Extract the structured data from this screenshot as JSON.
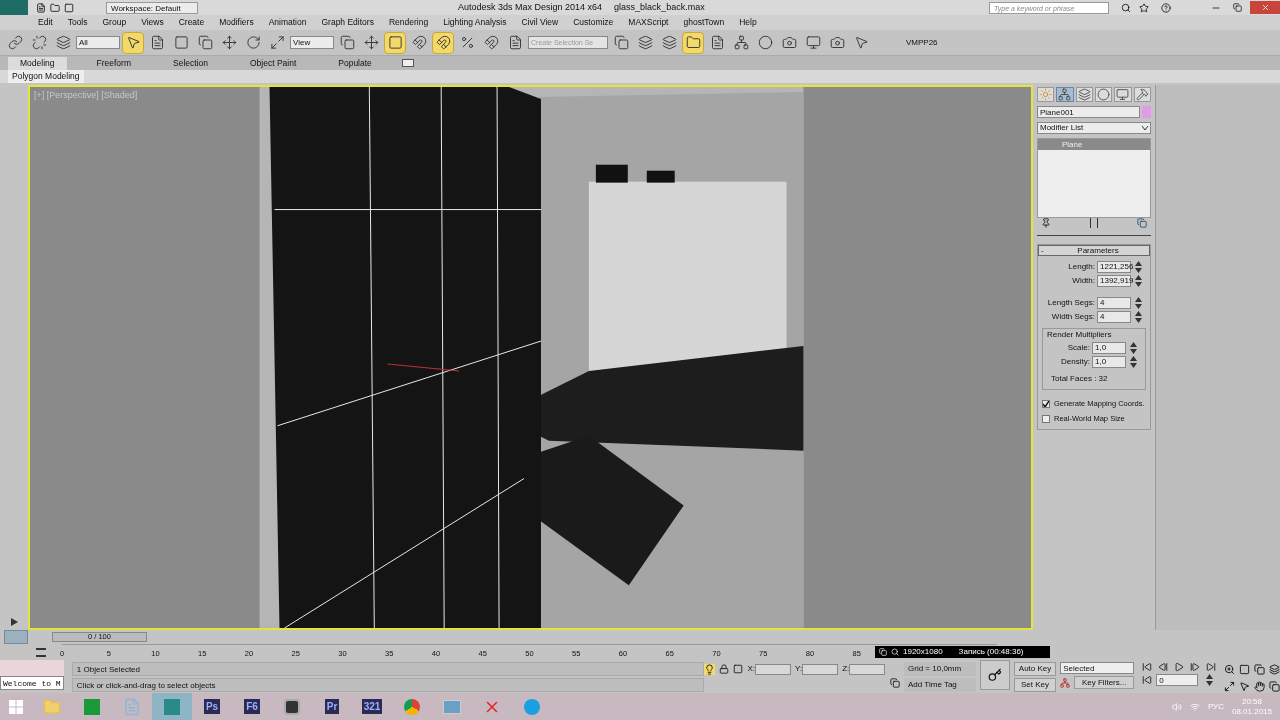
{
  "title_bar": {
    "workspace": "Workspace: Default",
    "app_title": "Autodesk 3ds Max Design 2014 x64",
    "file_name": "glass_black_back.max",
    "search_placeholder": "Type a keyword or phrase"
  },
  "menu": [
    "Edit",
    "Tools",
    "Group",
    "Views",
    "Create",
    "Modifiers",
    "Animation",
    "Graph Editors",
    "Rendering",
    "Lighting Analysis",
    "Civil View",
    "Customize",
    "MAXScript",
    "ghostTown",
    "Help"
  ],
  "toolbar": {
    "selection_filter": "All",
    "reference_coord": "View",
    "named_selection": "Create Selection Se",
    "custom_label": "VMPP26"
  },
  "ribbon_tabs": [
    {
      "label": "Modeling",
      "selected": true
    },
    {
      "label": "Freeform",
      "selected": false
    },
    {
      "label": "Selection",
      "selected": false
    },
    {
      "label": "Object Paint",
      "selected": false
    },
    {
      "label": "Populate",
      "selected": false
    }
  ],
  "ribbon_panel": "Polygon Modeling",
  "viewport": {
    "label": "[+] [Perspective] [Shaded]",
    "active": true
  },
  "command_panel": {
    "tabs": [
      {
        "kind": "create",
        "selected": false
      },
      {
        "kind": "modify",
        "selected": true
      },
      {
        "kind": "hierarchy",
        "selected": false
      },
      {
        "kind": "motion",
        "selected": false
      },
      {
        "kind": "display",
        "selected": false
      },
      {
        "kind": "utilities",
        "selected": false
      }
    ],
    "object_name": "Plane001",
    "modifier_list": "Modifier List",
    "stack": [
      {
        "label": "Plane",
        "selected": true
      }
    ],
    "rollout": "Parameters",
    "rollout_sign": "-",
    "fields": [
      {
        "label": "Length:",
        "value": "1221,256"
      },
      {
        "label": "Width:",
        "value": "1392,919"
      },
      {
        "label": "Length Segs:",
        "value": "4"
      },
      {
        "label": "Width Segs:",
        "value": "4"
      }
    ],
    "group": "Render Multipliers",
    "group_fields": [
      {
        "label": "Scale:",
        "value": "1,0"
      },
      {
        "label": "Density:",
        "value": "1,0"
      }
    ],
    "total_faces": "Total Faces : 32",
    "checkboxes": [
      {
        "label": "Generate Mapping Coords.",
        "checked": true
      },
      {
        "label": "Real-World Map Size",
        "checked": false
      }
    ]
  },
  "timeline": {
    "frame": "0 / 100",
    "ticks": [
      "0",
      "5",
      "10",
      "15",
      "20",
      "25",
      "30",
      "35",
      "40",
      "45",
      "50",
      "55",
      "60",
      "65",
      "70",
      "75",
      "80",
      "85"
    ]
  },
  "recorder": {
    "resolution": "1920x1080",
    "status": "Запись (00:48:36)"
  },
  "status": {
    "listener": "Welcome to M",
    "selected": "1 Object Selected",
    "prompt": "Click or click-and-drag to select objects",
    "coords": [
      "X:",
      "Y:",
      "Z:"
    ],
    "grid": "Grid = 10,0mm",
    "time_tag": "Add Time Tag",
    "auto_key": "Auto Key",
    "set_key": "Set Key",
    "key_mode": "Selected",
    "key_filters": "Key Filters...",
    "frame": "0"
  },
  "taskbar": {
    "apps": [
      {
        "kind": "folder"
      },
      {
        "kind": "store"
      },
      {
        "kind": "notepad"
      },
      {
        "kind": "max"
      },
      {
        "kind": "text",
        "label": "Ps"
      },
      {
        "kind": "text",
        "label": "F6"
      },
      {
        "kind": "max2"
      },
      {
        "kind": "text",
        "label": "Pr"
      },
      {
        "kind": "text",
        "label": "321"
      },
      {
        "kind": "chrome"
      },
      {
        "kind": "photo"
      },
      {
        "kind": "red"
      },
      {
        "kind": "skype"
      }
    ],
    "language": "РУС",
    "time": "20:58",
    "date": "08.01.2015"
  }
}
